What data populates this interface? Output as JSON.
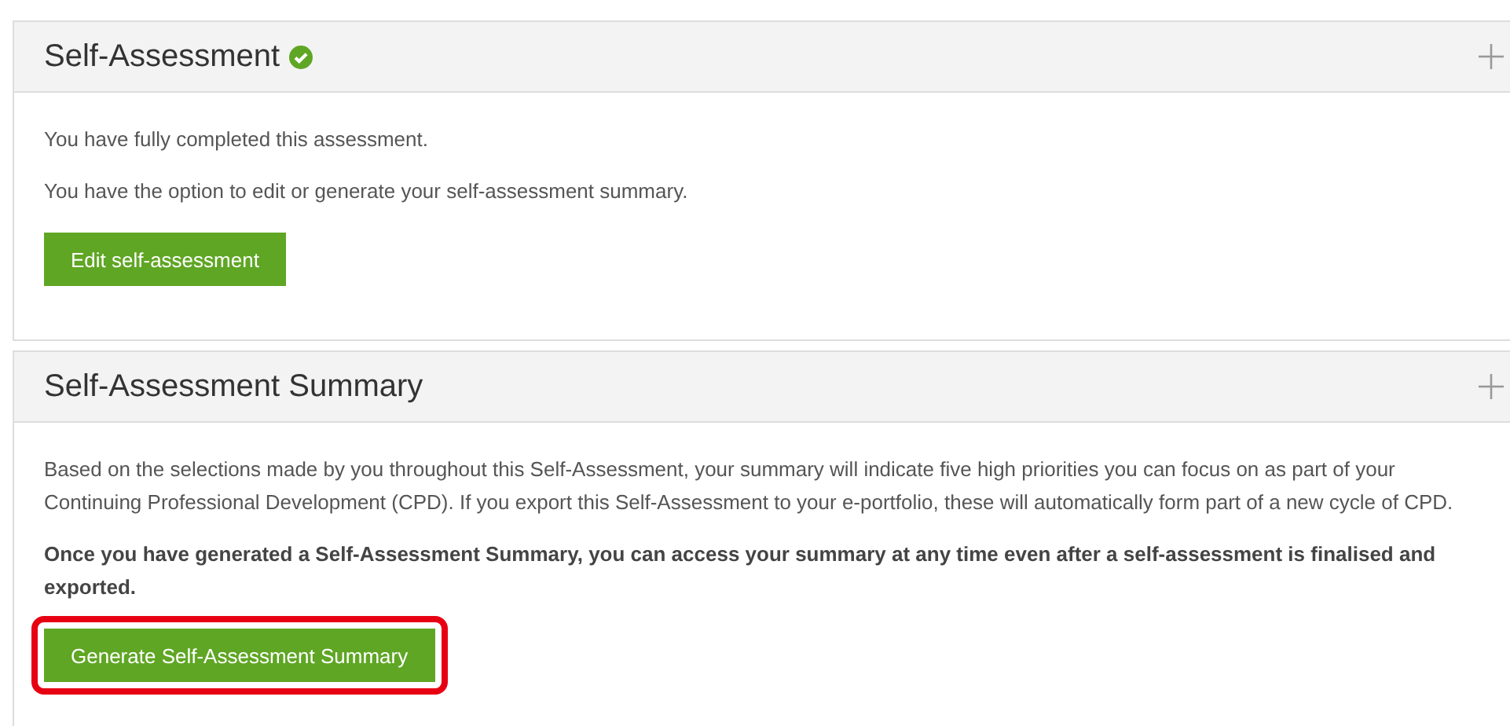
{
  "panels": [
    {
      "title": "Self-Assessment",
      "completed": true,
      "expanded": false,
      "paragraphs": [
        {
          "text": "You have fully completed this assessment.",
          "bold": false
        },
        {
          "text": "You have the option to edit or generate your self-assessment summary.",
          "bold": false
        }
      ],
      "button": {
        "label": "Edit self-assessment",
        "highlighted": false
      }
    },
    {
      "title": "Self-Assessment Summary",
      "completed": false,
      "expanded": false,
      "paragraphs": [
        {
          "text": "Based on the selections made by you throughout this Self-Assessment, your summary will indicate five high priorities you can focus on as part of your Continuing Professional Development (CPD). If you export this Self-Assessment to your e-portfolio, these will automatically form part of a new cycle of CPD.",
          "bold": false
        },
        {
          "text": "Once you have generated a Self-Assessment Summary, you can access your summary at any time even after a self-assessment is finalised and exported.",
          "bold": true
        }
      ],
      "button": {
        "label": "Generate Self-Assessment Summary",
        "highlighted": true
      }
    }
  ]
}
